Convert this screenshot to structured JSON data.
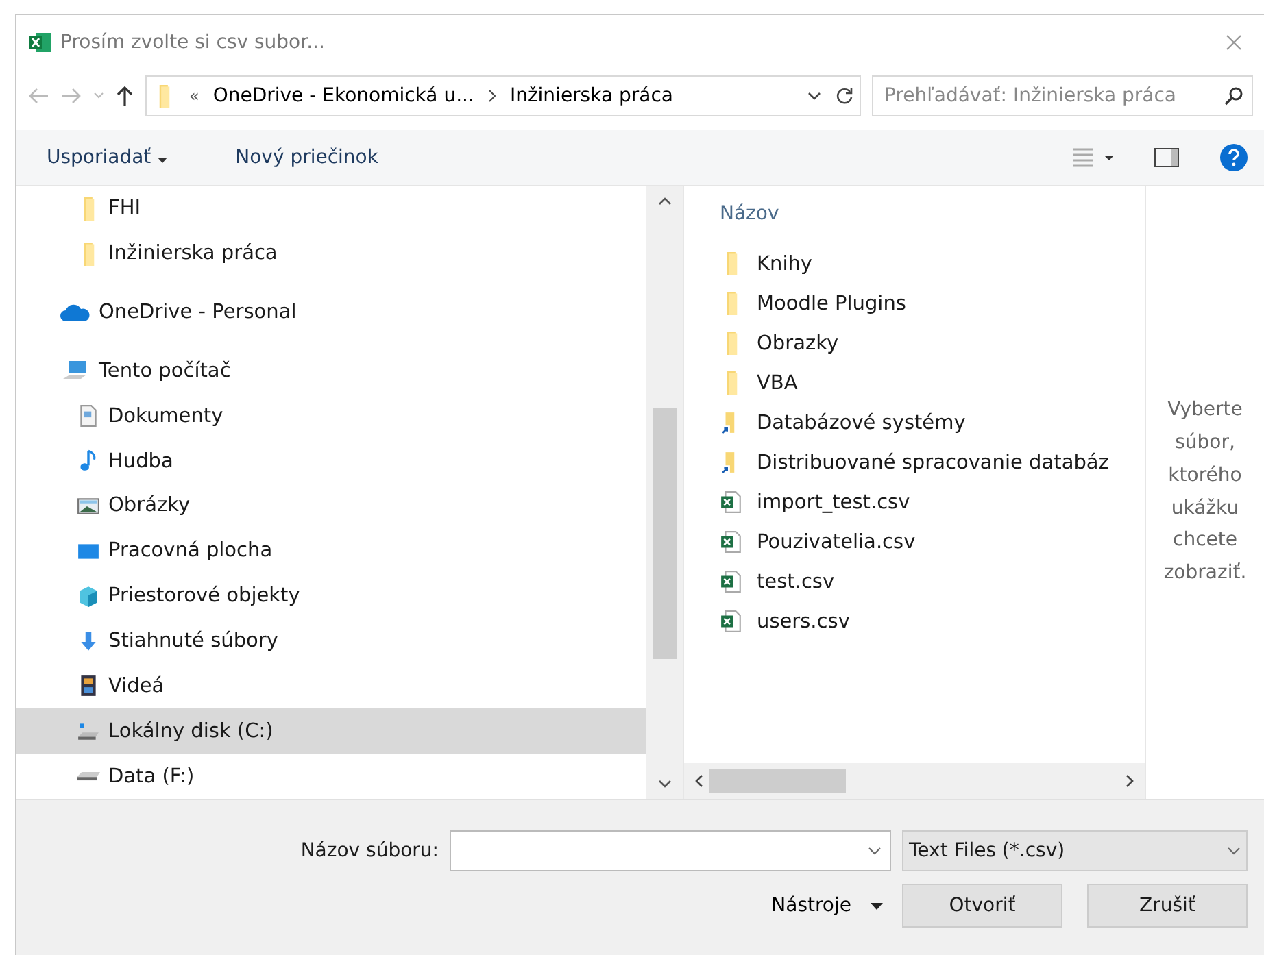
{
  "window": {
    "title": "Prosím zvolte si csv subor..."
  },
  "address_bar": {
    "overflow": "«",
    "segments": [
      "OneDrive - Ekonomická u...",
      "Inžinierska práca"
    ]
  },
  "search": {
    "placeholder": "Prehľadávať: Inžinierska práca"
  },
  "toolbar": {
    "buttons": [
      "Usporiadať",
      "Nový priečinok"
    ]
  },
  "nav_pane": {
    "items": [
      {
        "children": [
          {
            "label": "FHI",
            "kind": "folder",
            "selected": false
          },
          {
            "label": "Inžinierska práca",
            "kind": "folder",
            "selected": false
          }
        ]
      },
      {
        "label": "OneDrive - Personal",
        "kind": "cloud",
        "selected": false
      },
      {
        "label": "Tento počítač",
        "kind": "computer",
        "selected": false,
        "children": [
          {
            "label": "Dokumenty",
            "kind": "documents",
            "selected": false
          },
          {
            "label": "Hudba",
            "kind": "music",
            "selected": false
          },
          {
            "label": "Obrázky",
            "kind": "pictures",
            "selected": false
          },
          {
            "label": "Pracovná plocha",
            "kind": "desktop",
            "selected": false
          },
          {
            "label": "Priestorové objekty",
            "kind": "objects",
            "selected": false
          },
          {
            "label": "Stiahnuté súbory",
            "kind": "downloads",
            "selected": false
          },
          {
            "label": "Videá",
            "kind": "videos",
            "selected": false
          },
          {
            "label": "Lokálny disk (C:)",
            "kind": "disk",
            "selected": true
          },
          {
            "label": "Data (F:)",
            "kind": "drive",
            "selected": false
          }
        ]
      }
    ]
  },
  "file_list": {
    "column": "Názov",
    "files": [
      {
        "name": "Knihy",
        "kind": "folder"
      },
      {
        "name": "Moodle Plugins",
        "kind": "folder"
      },
      {
        "name": "Obrazky",
        "kind": "folder"
      },
      {
        "name": "VBA",
        "kind": "folder"
      },
      {
        "name": "Databázové systémy",
        "kind": "shortcut"
      },
      {
        "name": "Distribuované spracovanie databáz",
        "kind": "shortcut"
      },
      {
        "name": "import_test.csv",
        "kind": "csv"
      },
      {
        "name": "Pouzivatelia.csv",
        "kind": "csv"
      },
      {
        "name": "test.csv",
        "kind": "csv"
      },
      {
        "name": "users.csv",
        "kind": "csv"
      }
    ]
  },
  "preview": {
    "message": "Vyberte súbor, ktorého ukážku chcete zobraziť."
  },
  "footer": {
    "filename_label": "Názov súboru:",
    "file_type": "Text Files (*.csv)",
    "tools": "Nástroje",
    "buttons": [
      "Otvoriť",
      "Zrušiť"
    ]
  }
}
